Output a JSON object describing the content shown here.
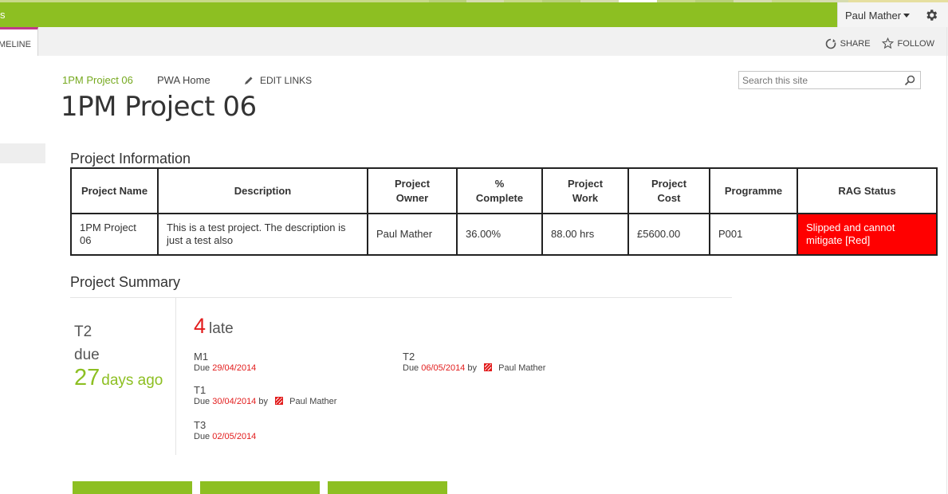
{
  "suite": {
    "app_letter": "s",
    "user_name": "Paul Mather",
    "accent_color": "#8dbf22"
  },
  "ribbon": {
    "tab_label": "MELINE",
    "share_label": "SHARE",
    "follow_label": "FOLLOW"
  },
  "nav": {
    "site_link": "1PM Project 06",
    "home_link": "PWA Home",
    "edit_links": "EDIT LINKS"
  },
  "page_title": "1PM Project 06",
  "search": {
    "placeholder": "Search this site"
  },
  "project_info": {
    "title": "Project Information",
    "headers": [
      "Project Name",
      "Description",
      "Project Owner",
      "% Complete",
      "Project Work",
      "Project Cost",
      "Programme",
      "RAG Status"
    ],
    "row": {
      "name": "1PM Project 06",
      "description": "This is a test project. The description is just a test also",
      "owner": "Paul Mather",
      "complete": "36.00%",
      "work": "88.00 hrs",
      "cost": "£5600.00",
      "programme": "P001",
      "rag": "Slipped and cannot mitigate [Red]"
    },
    "rag_color": "#ff0000"
  },
  "project_summary": {
    "title": "Project Summary",
    "next_task": "T2",
    "due_label": "due",
    "days_num": "27",
    "days_text": "days ago",
    "late_count": "4",
    "late_label": "late",
    "late_tasks": [
      {
        "name": "M1",
        "due_prefix": "Due",
        "date": "29/04/2014",
        "by": "",
        "person": ""
      },
      {
        "name": "T1",
        "due_prefix": "Due",
        "date": "30/04/2014",
        "by": "by",
        "person": "Paul Mather"
      },
      {
        "name": "T3",
        "due_prefix": "Due",
        "date": "02/05/2014",
        "by": "",
        "person": ""
      },
      {
        "name": "T2",
        "due_prefix": "Due",
        "date": "06/05/2014",
        "by": "by",
        "person": "Paul Mather"
      }
    ]
  }
}
